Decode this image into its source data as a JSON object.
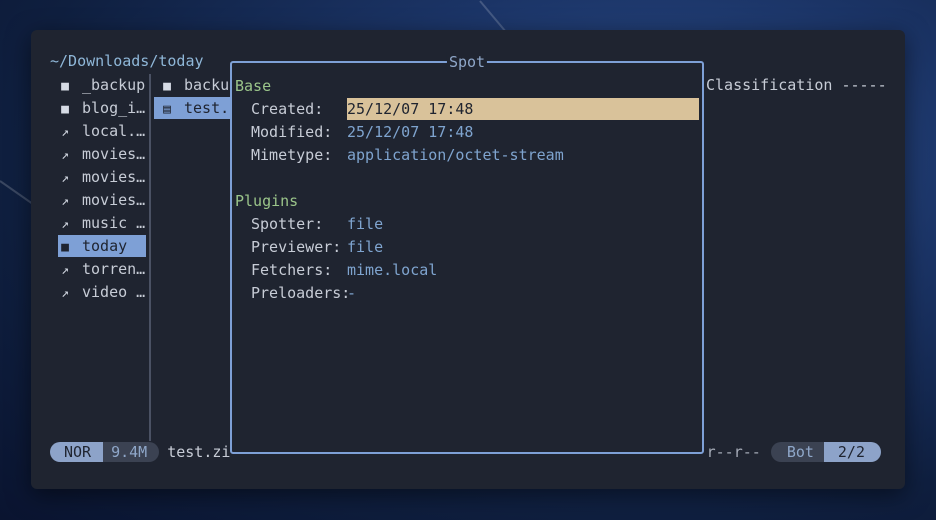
{
  "path": "~/Downloads/today",
  "parent_list": [
    {
      "icon": "folder-icon",
      "name": "_backup"
    },
    {
      "icon": "folder-icon",
      "name": "blog_i…"
    },
    {
      "icon": "link-icon",
      "name": "local.…"
    },
    {
      "icon": "link-icon",
      "name": "movies…"
    },
    {
      "icon": "link-icon",
      "name": "movies…"
    },
    {
      "icon": "link-icon",
      "name": "movies…"
    },
    {
      "icon": "link-icon",
      "name": "music …"
    },
    {
      "icon": "folder-icon",
      "name": "today"
    },
    {
      "icon": "link-icon",
      "name": "torren…"
    },
    {
      "icon": "link-icon",
      "name": "video …"
    }
  ],
  "current_list": [
    {
      "icon": "folder-icon",
      "name": "backu"
    },
    {
      "icon": "file-icon",
      "name": "test."
    }
  ],
  "preview_text": "Classification -----",
  "spot": {
    "title": "Spot",
    "base_label": "Base",
    "created_label": "Created:",
    "created_value": "25/12/07 17:48",
    "modified_label": "Modified:",
    "modified_value": "25/12/07 17:48",
    "mimetype_label": "Mimetype:",
    "mimetype_value": "application/octet-stream",
    "plugins_label": "Plugins",
    "spotter_label": "Spotter:",
    "spotter_value": "file",
    "previewer_label": "Previewer:",
    "previewer_value": "file",
    "fetchers_label": "Fetchers:",
    "fetchers_value": "mime.local",
    "preloaders_label": "Preloaders:",
    "preloaders_value": "-"
  },
  "status": {
    "mode": "NOR",
    "size": "9.4M",
    "filename": "test.zi",
    "permissions": "r--r--",
    "position": "Bot",
    "count": "2/2"
  },
  "colors": {
    "accent": "#7ea0d6",
    "highlight": "#d9c29a",
    "section": "#9bc58a",
    "value": "#7fa4cf",
    "background": "#1f2430"
  }
}
